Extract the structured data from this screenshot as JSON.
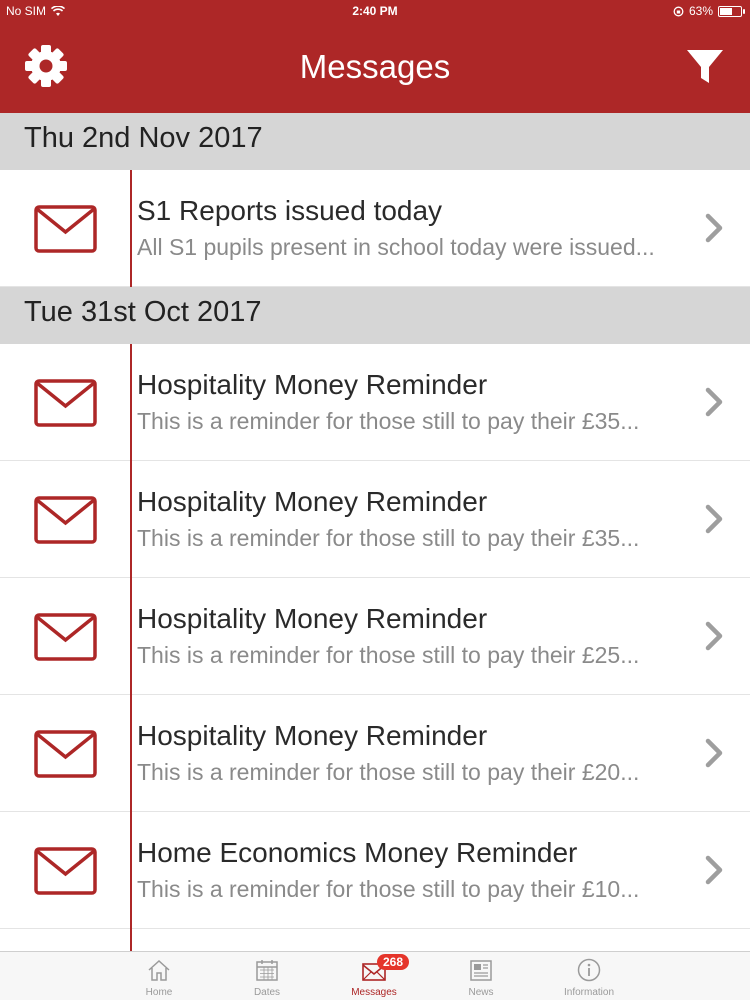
{
  "status_bar": {
    "carrier": "No SIM",
    "time": "2:40 PM",
    "battery": "63%",
    "battery_level": 0.63
  },
  "nav": {
    "title": "Messages",
    "left_icon": "gear-icon",
    "right_icon": "filter-icon"
  },
  "sections": [
    {
      "date": "Thu 2nd Nov 2017",
      "items": [
        {
          "title": "S1 Reports issued today",
          "preview": "All S1 pupils present in school today were issued..."
        }
      ]
    },
    {
      "date": "Tue 31st Oct 2017",
      "items": [
        {
          "title": "Hospitality Money Reminder",
          "preview": "This is a reminder for those still to pay their £35..."
        },
        {
          "title": "Hospitality Money Reminder",
          "preview": "This is a reminder for those still to pay their £35..."
        },
        {
          "title": "Hospitality Money Reminder",
          "preview": "This is a reminder for those still to pay their £25..."
        },
        {
          "title": "Hospitality Money Reminder",
          "preview": "This is a reminder for those still to pay their £20..."
        },
        {
          "title": "Home Economics Money Reminder",
          "preview": "This is a reminder for those still to pay their £10..."
        }
      ]
    }
  ],
  "tabbar": {
    "tabs": [
      {
        "label": "Home",
        "icon": "home-icon"
      },
      {
        "label": "Dates",
        "icon": "calendar-icon"
      },
      {
        "label": "Messages",
        "icon": "envelope-icon",
        "badge": "268",
        "active": true
      },
      {
        "label": "News",
        "icon": "newspaper-icon"
      },
      {
        "label": "Information",
        "icon": "info-icon"
      }
    ]
  },
  "colors": {
    "brand": "#ad2727",
    "section_bg": "#d6d6d6",
    "badge": "#e5352b"
  }
}
